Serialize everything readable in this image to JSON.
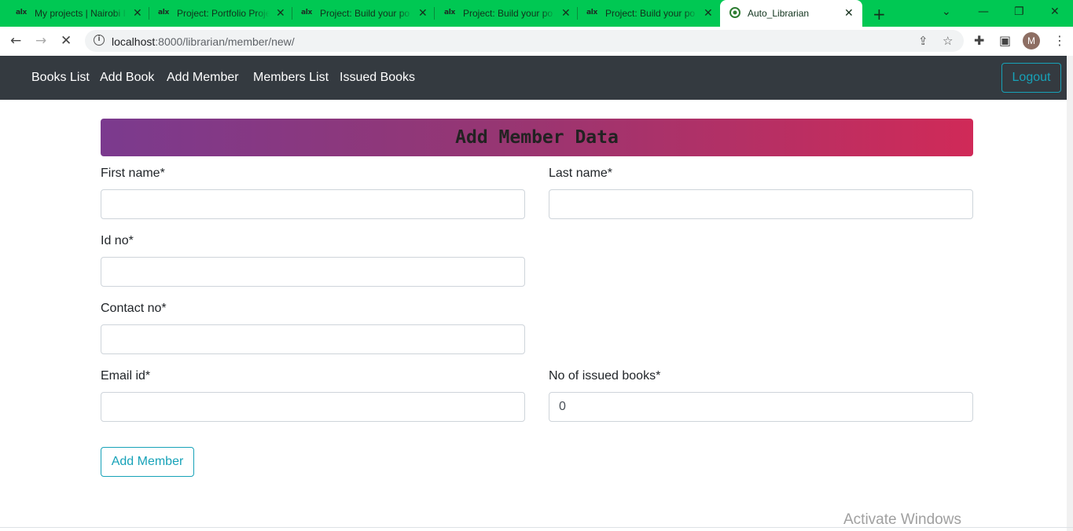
{
  "browser": {
    "tabs": [
      {
        "favicon": "alx",
        "title": "My projects | Nairobi I"
      },
      {
        "favicon": "alx",
        "title": "Project: Portfolio Proje"
      },
      {
        "favicon": "alx",
        "title": "Project: Build your po"
      },
      {
        "favicon": "alx",
        "title": "Project: Build your po"
      },
      {
        "favicon": "alx",
        "title": "Project: Build your po"
      },
      {
        "favicon": "librarian-icon",
        "title": "Auto_Librarian"
      }
    ],
    "new_tab": "+",
    "url_host": "localhost",
    "url_rest": ":8000/librarian/member/new/",
    "avatar_letter": "M",
    "accent_color": "#00c853"
  },
  "nav": {
    "links": [
      "Books List",
      "Add Book",
      "Add Member",
      "Members List",
      "Issued Books"
    ],
    "logout": "Logout"
  },
  "form": {
    "title": "Add Member Data",
    "first_name_label": "First name*",
    "last_name_label": "Last name*",
    "id_no_label": "Id no*",
    "contact_no_label": "Contact no*",
    "email_label": "Email id*",
    "issued_books_label": "No of issued books*",
    "issued_books_value": "0",
    "submit": "Add Member"
  },
  "watermark": "Activate Windows"
}
